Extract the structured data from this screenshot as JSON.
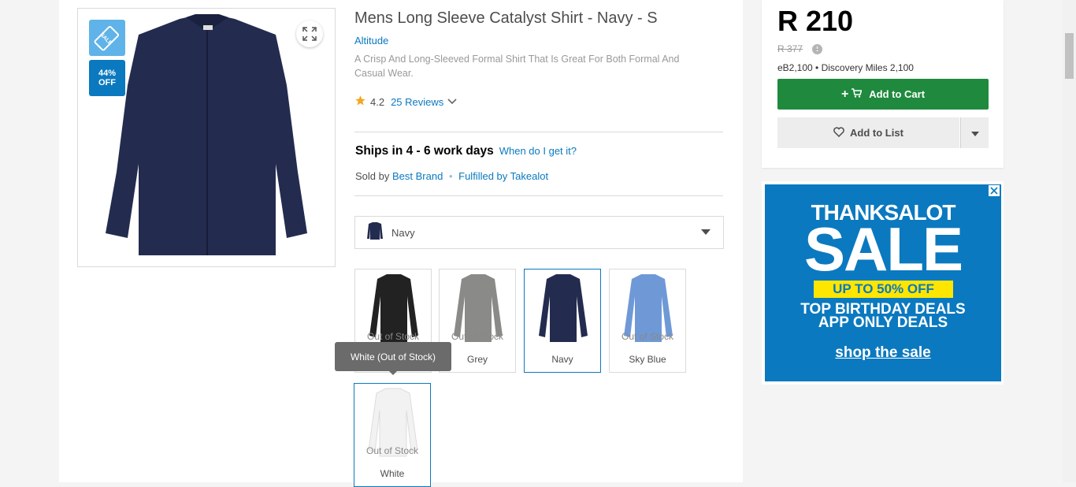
{
  "gallery": {
    "sale_tag": "SALE",
    "discount_percent": "44%",
    "discount_label": "OFF",
    "expand_icon": "expand-icon"
  },
  "product": {
    "title": "Mens Long Sleeve Catalyst Shirt - Navy - S",
    "brand": "Altitude",
    "description": "A Crisp And Long-Sleeved Formal Shirt That Is Great For Both Formal And Casual Wear.",
    "rating": "4.2",
    "reviews_label": "25 Reviews"
  },
  "shipping": {
    "ships_text": "Ships in 4 - 6 work days",
    "when_link": "When do I get it?",
    "sold_by_prefix": "Sold by",
    "seller": "Best Brand",
    "fulfilled": "Fulfilled by Takealot"
  },
  "variant_select": {
    "selected": "Navy"
  },
  "variants": [
    {
      "name": "",
      "status": "Out of Stock",
      "color": "#222222"
    },
    {
      "name": "Grey",
      "status": "Out of Stock",
      "color": "#8a8a88"
    },
    {
      "name": "Navy",
      "status": "",
      "color": "#232c4f"
    },
    {
      "name": "Sky Blue",
      "status": "Out of Stock",
      "color": "#6f99d6"
    },
    {
      "name": "White",
      "status": "Out of Stock",
      "color": "#f2f2f2"
    }
  ],
  "tooltip": "White (Out of Stock)",
  "buy_box": {
    "price": "R 210",
    "old_price": "R 377",
    "info_icon": "i",
    "rewards": "eB2,100 • Discovery Miles 2,100",
    "add_to_cart": "Add to Cart",
    "add_to_list": "Add to List"
  },
  "ad": {
    "line1": "THANKSALOT",
    "line2": "SALE",
    "banner": "UP TO 50% OFF",
    "line3": "TOP BIRTHDAY DEALS",
    "line4": "APP ONLY DEALS",
    "cta": "shop the sale"
  },
  "colors": {
    "accent": "#0b79bf",
    "cart_green": "#1f8a3e",
    "star": "#f5a623"
  }
}
